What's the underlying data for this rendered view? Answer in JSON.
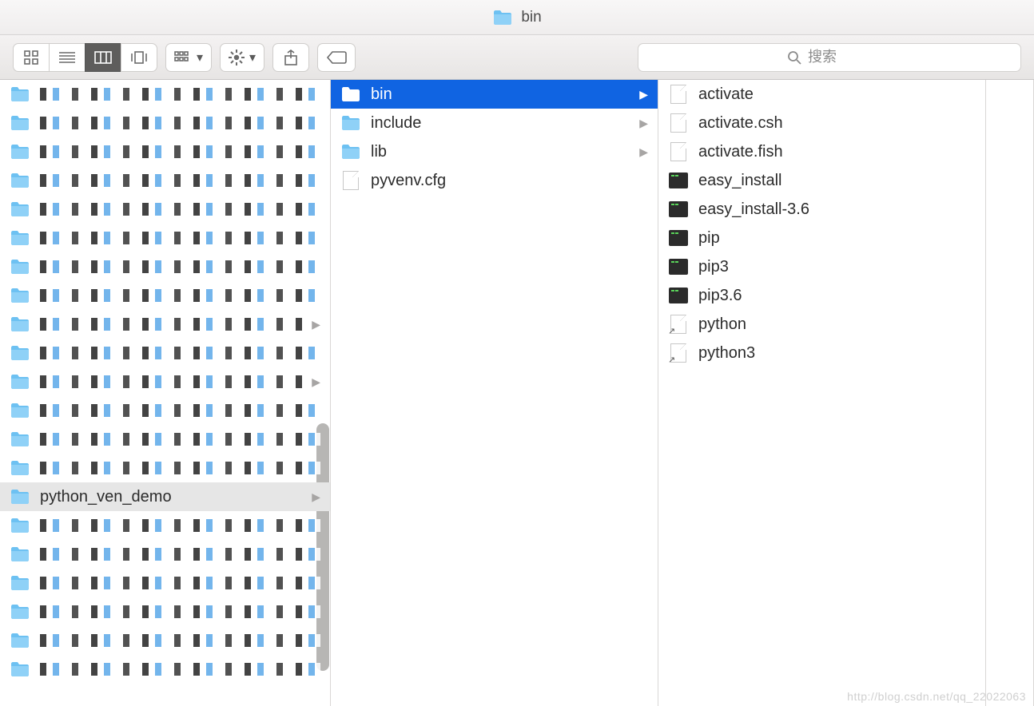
{
  "window": {
    "title": "bin"
  },
  "search": {
    "placeholder": "搜索"
  },
  "sidebar": {
    "items": [
      {
        "selected": false,
        "open": false,
        "arrow": false
      },
      {
        "selected": false,
        "open": false,
        "arrow": false
      },
      {
        "selected": false,
        "open": false,
        "arrow": false
      },
      {
        "selected": false,
        "open": false,
        "arrow": false
      },
      {
        "selected": false,
        "open": false,
        "arrow": false
      },
      {
        "selected": false,
        "open": false,
        "arrow": false
      },
      {
        "selected": false,
        "open": false,
        "arrow": false
      },
      {
        "selected": false,
        "open": false,
        "arrow": false
      },
      {
        "selected": false,
        "open": false,
        "arrow": true
      },
      {
        "selected": false,
        "open": false,
        "arrow": false
      },
      {
        "selected": false,
        "open": false,
        "arrow": true
      },
      {
        "selected": false,
        "open": false,
        "arrow": false
      },
      {
        "selected": false,
        "open": false,
        "arrow": false
      },
      {
        "selected": false,
        "open": false,
        "arrow": false
      },
      {
        "label": "python_ven_demo",
        "selected": false,
        "open": true,
        "arrow": true
      },
      {
        "selected": false,
        "open": false,
        "arrow": false
      },
      {
        "selected": false,
        "open": false,
        "arrow": false
      },
      {
        "selected": false,
        "open": false,
        "arrow": false
      },
      {
        "selected": false,
        "open": false,
        "arrow": false
      },
      {
        "selected": false,
        "open": false,
        "arrow": false
      },
      {
        "selected": false,
        "open": false,
        "arrow": false
      }
    ]
  },
  "col2": {
    "items": [
      {
        "kind": "folder",
        "label": "bin",
        "arrow": true,
        "selected": true
      },
      {
        "kind": "folder",
        "label": "include",
        "arrow": true,
        "selected": false
      },
      {
        "kind": "folder",
        "label": "lib",
        "arrow": true,
        "selected": false
      },
      {
        "kind": "doc",
        "label": "pyvenv.cfg",
        "arrow": false,
        "selected": false
      }
    ]
  },
  "col3": {
    "items": [
      {
        "kind": "doc",
        "label": "activate"
      },
      {
        "kind": "doc",
        "label": "activate.csh"
      },
      {
        "kind": "doc",
        "label": "activate.fish"
      },
      {
        "kind": "exec",
        "label": "easy_install"
      },
      {
        "kind": "exec",
        "label": "easy_install-3.6"
      },
      {
        "kind": "exec",
        "label": "pip"
      },
      {
        "kind": "exec",
        "label": "pip3"
      },
      {
        "kind": "exec",
        "label": "pip3.6"
      },
      {
        "kind": "link",
        "label": "python"
      },
      {
        "kind": "link",
        "label": "python3"
      }
    ]
  },
  "watermark": "http://blog.csdn.net/qq_22022063"
}
